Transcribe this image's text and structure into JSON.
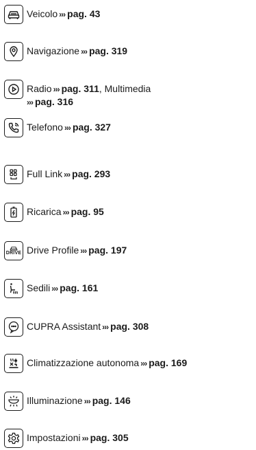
{
  "arrow": "›››",
  "items": [
    {
      "icon": "car-icon",
      "label": "Veicolo",
      "page": "pag. 43"
    },
    {
      "icon": "navigation-pin-icon",
      "label": "Navigazione",
      "page": "pag. 319"
    },
    {
      "icon": "play-icon",
      "label": "Radio",
      "page": "pag. 311",
      "sep": ", ",
      "label2": "Multimedia",
      "page2": "pag. 316"
    },
    {
      "icon": "phone-icon",
      "label": "Telefono",
      "page": "pag. 327"
    },
    {
      "icon": "full-link-icon",
      "label": "Full Link",
      "page": "pag. 293"
    },
    {
      "icon": "battery-charge-icon",
      "label": "Ricarica",
      "page": "pag. 95"
    },
    {
      "icon": "drive-profile-icon",
      "icon_text": "DRIVE",
      "label": "Drive Profile",
      "page": "pag. 197"
    },
    {
      "icon": "seat-heating-icon",
      "label": "Sedili",
      "page": "pag. 161"
    },
    {
      "icon": "assistant-icon",
      "label": "CUPRA Assistant",
      "page": "pag. 308"
    },
    {
      "icon": "climate-icon",
      "label": "Climatizzazione autonoma",
      "page": "pag. 169"
    },
    {
      "icon": "lighting-icon",
      "label": "Illuminazione",
      "page": "pag. 146"
    },
    {
      "icon": "settings-gear-icon",
      "label": "Impostazioni",
      "page": "pag. 305"
    }
  ]
}
